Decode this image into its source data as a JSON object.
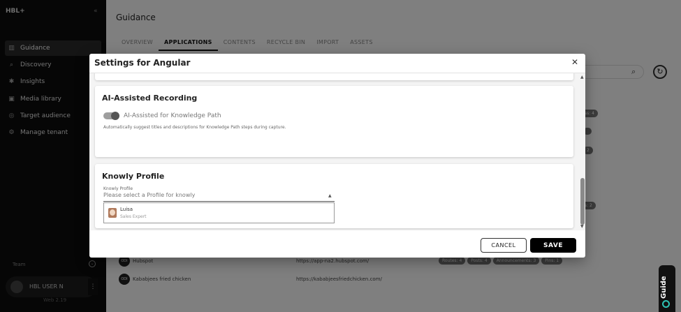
{
  "sidebar": {
    "logo": "HBL+",
    "collapse_icon": "«",
    "items": [
      {
        "label": "Guidance",
        "icon": "chart-icon"
      },
      {
        "label": "Discovery",
        "icon": "search-icon"
      },
      {
        "label": "Insights",
        "icon": "bulb-icon"
      },
      {
        "label": "Media library",
        "icon": "media-icon"
      },
      {
        "label": "Target audience",
        "icon": "target-icon"
      },
      {
        "label": "Manage tenant",
        "icon": "gear-icon"
      }
    ],
    "footer_label": "Team",
    "user_name": "HBL USER N",
    "version": "Web 2.19"
  },
  "main": {
    "title": "Guidance",
    "tabs": [
      "OVERVIEW",
      "APPLICATIONS",
      "CONTENTS",
      "RECYCLE BIN",
      "IMPORT",
      "ASSETS"
    ],
    "active_tab": 1,
    "rows": [
      {
        "name": "Hubspot",
        "url": "https://app-na2.hubspot.com/",
        "tags": [
          "Routes: 4",
          "Posts: 4",
          "Announcements: 3",
          "Pins: 1"
        ]
      },
      {
        "name": "Kababjees fried chicken",
        "url": "https://kababjeesfriedchicken.com/",
        "tags": []
      }
    ],
    "edge_tags": [
      "ss: 4",
      "",
      "2",
      "s: 2"
    ]
  },
  "dialog": {
    "title": "Settings for Angular",
    "ai_section": {
      "heading": "AI-Assisted Recording",
      "toggle_label": "AI-Assisted for Knowledge Path",
      "toggle_on": true,
      "helper": "Automatically suggest titles and descriptions for Knowledge Path steps during capture."
    },
    "profile_section": {
      "heading": "Knowly Profile",
      "field_label": "Knowly Profile",
      "placeholder": "Please select a Profile for knowly",
      "options": [
        {
          "name": "Luisa",
          "role": "Sales Expert"
        }
      ]
    },
    "cancel_label": "CANCEL",
    "save_label": "SAVE"
  },
  "guide_tab": {
    "label": "Guide"
  }
}
